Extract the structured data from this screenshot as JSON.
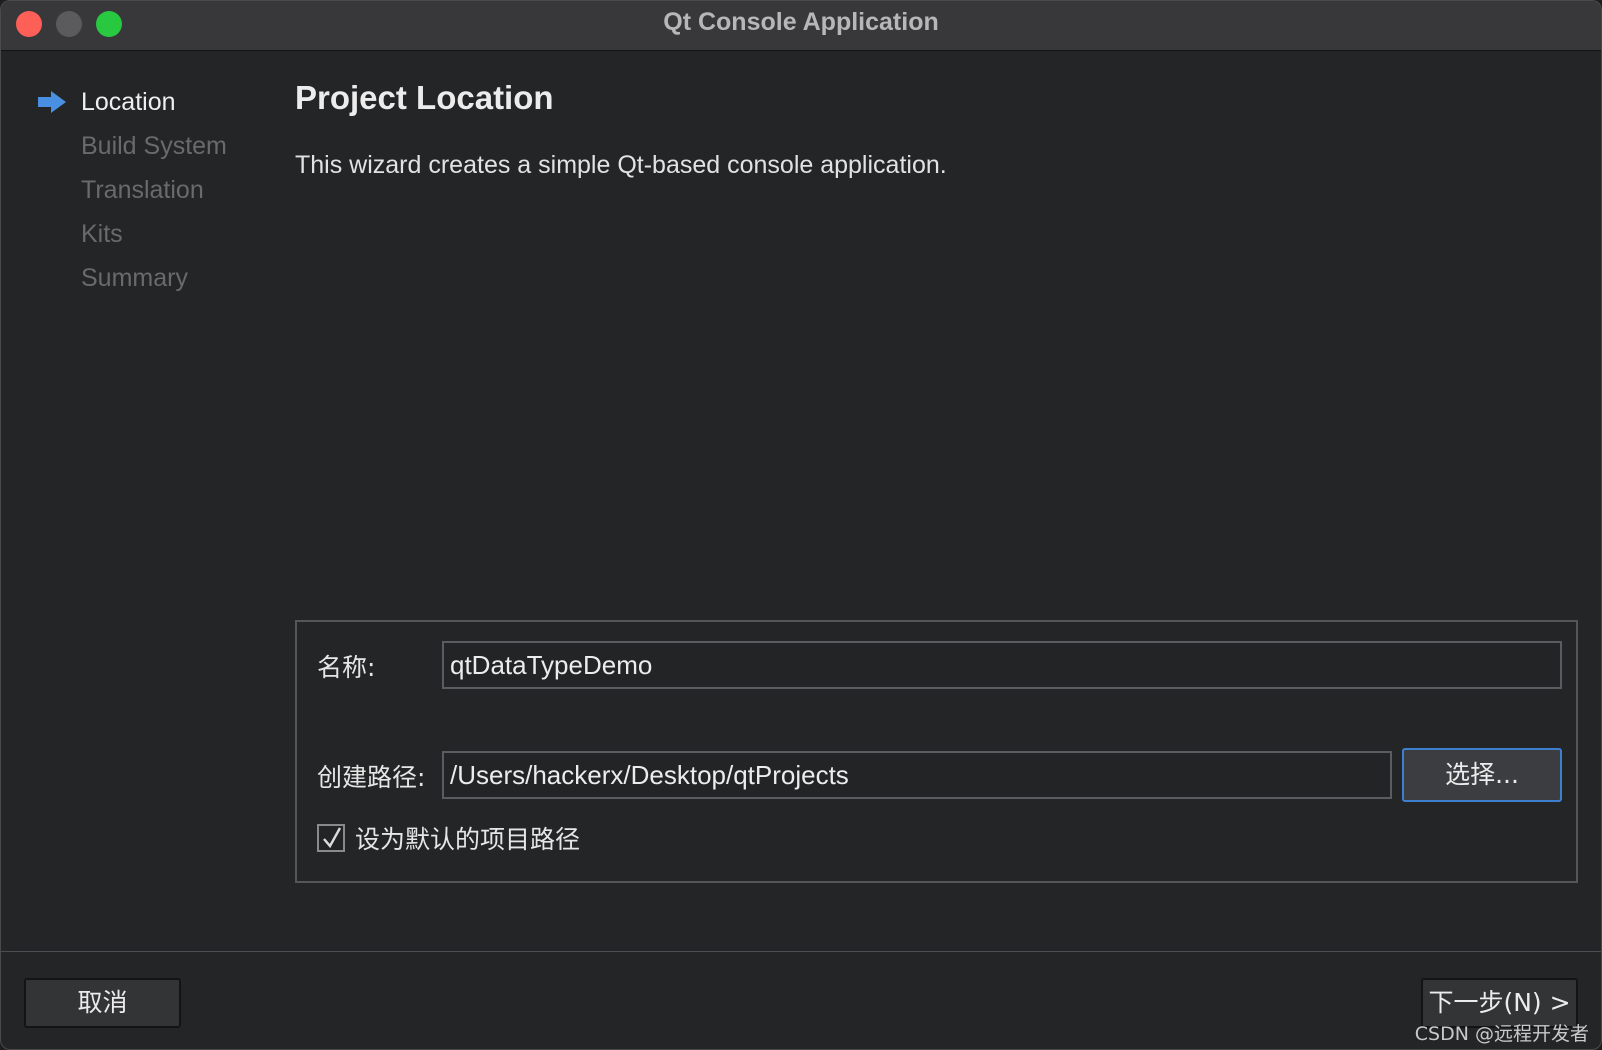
{
  "window": {
    "title": "Qt Console Application"
  },
  "steps": [
    {
      "label": "Location",
      "active": true
    },
    {
      "label": "Build System",
      "active": false
    },
    {
      "label": "Translation",
      "active": false
    },
    {
      "label": "Kits",
      "active": false
    },
    {
      "label": "Summary",
      "active": false
    }
  ],
  "page": {
    "title": "Project Location",
    "description": "This wizard creates a simple Qt-based console application."
  },
  "form": {
    "name_label": "名称:",
    "name_value": "qtDataTypeDemo",
    "path_label": "创建路径:",
    "path_value": "/Users/hackerx/Desktop/qtProjects",
    "choose_label": "选择...",
    "default_checkbox_label": "设为默认的项目路径",
    "default_checked": true
  },
  "footer": {
    "cancel_label": "取消",
    "next_label": "下一步(N) >"
  },
  "watermark": "CSDN @远程开发者",
  "colors": {
    "accent": "#3f7fd0",
    "close": "#fe5f57",
    "maximize": "#28c840",
    "arrow": "#4a90e2"
  }
}
